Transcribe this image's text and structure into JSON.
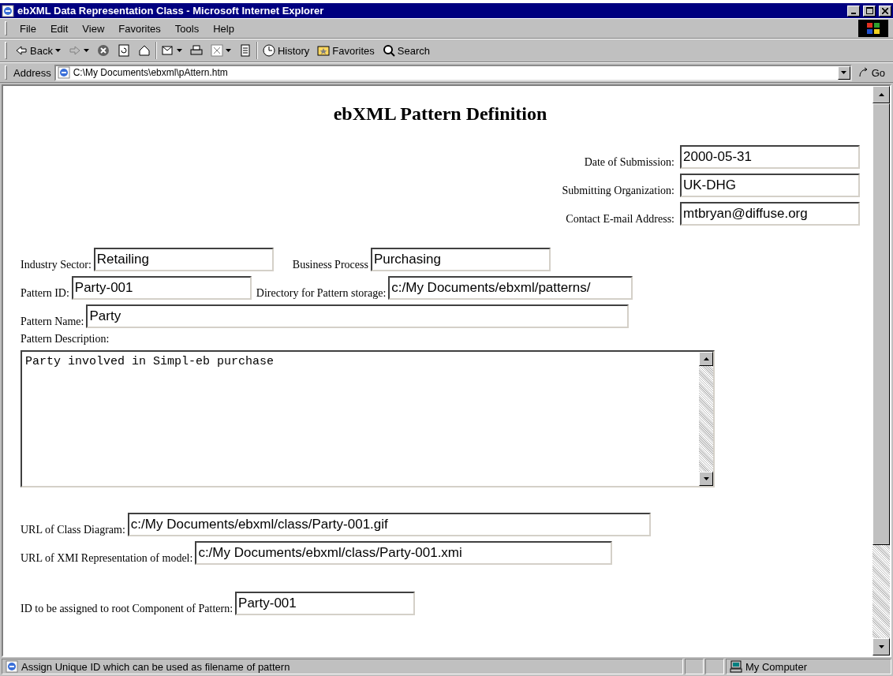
{
  "window": {
    "title": "ebXML Data Representation Class - Microsoft Internet Explorer"
  },
  "menu": [
    {
      "label": "File"
    },
    {
      "label": "Edit"
    },
    {
      "label": "View"
    },
    {
      "label": "Favorites"
    },
    {
      "label": "Tools"
    },
    {
      "label": "Help"
    }
  ],
  "toolbar": [
    {
      "kind": "back",
      "label": "Back"
    },
    {
      "kind": "forward"
    },
    {
      "kind": "stop"
    },
    {
      "kind": "refresh"
    },
    {
      "kind": "home"
    },
    {
      "kind": "sep"
    },
    {
      "kind": "mail"
    },
    {
      "kind": "print"
    },
    {
      "kind": "edit"
    },
    {
      "kind": "discuss"
    },
    {
      "kind": "sep"
    },
    {
      "kind": "history",
      "label": "History"
    },
    {
      "kind": "favorites",
      "label": "Favorites"
    },
    {
      "kind": "search",
      "label": "Search"
    }
  ],
  "address": {
    "label": "Address",
    "value": "C:\\My Documents\\ebxml\\pAttern.htm",
    "go": "Go"
  },
  "page": {
    "heading": "ebXML Pattern Definition",
    "header_fields": [
      {
        "label": "Date of Submission:",
        "value": "2000-05-31"
      },
      {
        "label": "Submitting Organization:",
        "value": "UK-DHG"
      },
      {
        "label": "Contact E-mail Address:",
        "value": "mtbryan@diffuse.org"
      }
    ],
    "rows": [
      [
        {
          "label": "Industry Sector:",
          "value": "Retailing"
        },
        {
          "label": "Business Process",
          "value": "Purchasing"
        }
      ],
      [
        {
          "label": "Pattern ID:",
          "value": "Party-001"
        },
        {
          "label": "Directory for Pattern storage:",
          "value": "c:/My Documents/ebxml/patterns/"
        }
      ],
      [
        {
          "label": "Pattern Name:",
          "value": "Party"
        }
      ]
    ],
    "description": {
      "label": "Pattern Description:",
      "value": "Party involved in Simpl-eb purchase"
    },
    "url_fields": [
      {
        "label": "URL of Class Diagram:",
        "value": "c:/My Documents/ebxml/class/Party-001.gif"
      },
      {
        "label": "URL of XMI Representation of model:",
        "value": "c:/My Documents/ebxml/class/Party-001.xmi"
      }
    ],
    "root_field": {
      "label": "ID to be assigned to root Component of Pattern:",
      "value": "Party-001"
    }
  },
  "status_bar": {
    "text": "Assign Unique ID which can be used as filename of pattern",
    "zone": "My Computer"
  }
}
